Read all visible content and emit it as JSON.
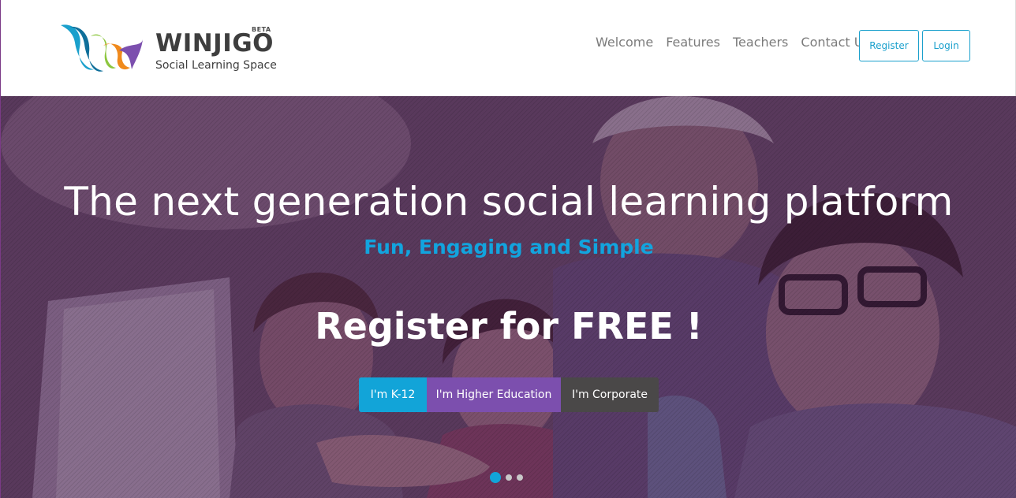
{
  "brand": {
    "name": "WINJIGO",
    "badge": "BETA",
    "tagline": "Social Learning Space",
    "colors": [
      "#1aa0cc",
      "#7c4fae",
      "#f08a1c",
      "#8dc63f"
    ]
  },
  "nav": {
    "items": [
      {
        "label": "Welcome"
      },
      {
        "label": "Features"
      },
      {
        "label": "Teachers"
      },
      {
        "label": "Contact Us"
      }
    ],
    "register_label": "Register",
    "login_label": "Login"
  },
  "hero": {
    "title": "The next generation social learning platform",
    "subtitle": "Fun, Engaging and Simple",
    "cta": "Register for FREE !",
    "buttons": [
      {
        "label": "I'm K-12",
        "color": "#12a4d8"
      },
      {
        "label": "I'm Higher Education",
        "color": "#7c4fae"
      },
      {
        "label": "I'm Corporate",
        "color": "#4a4848"
      }
    ],
    "slides": {
      "count": 3,
      "active": 1
    }
  }
}
